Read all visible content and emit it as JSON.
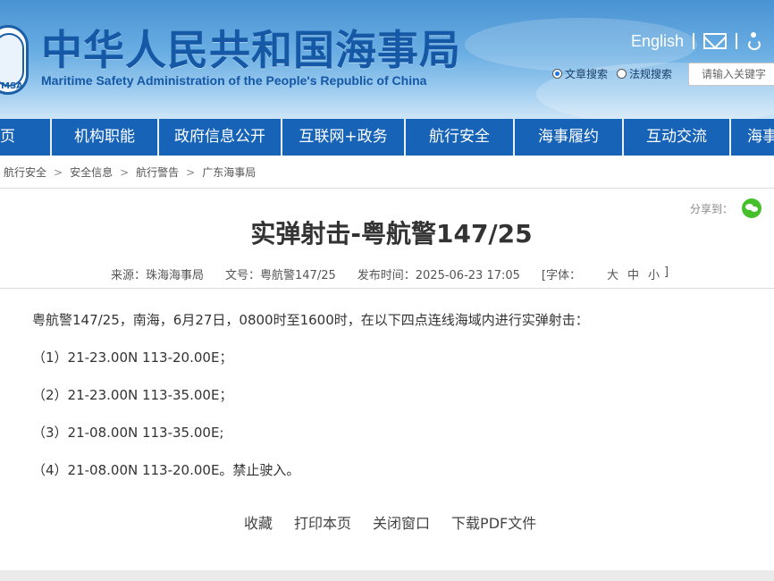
{
  "header": {
    "title_cn": "中华人民共和国海事局",
    "title_en": "Maritime Safety Administration of the People's Republic of China",
    "logo_text": "MSA",
    "english_link": "English",
    "search_options": [
      "文章搜索",
      "法规搜索"
    ],
    "search_placeholder": "请输入关键字"
  },
  "nav": {
    "items": [
      "首页",
      "机构职能",
      "政府信息公开",
      "互联网+政务",
      "航行安全",
      "海事履约",
      "互动交流",
      "海事服务"
    ]
  },
  "breadcrumb": [
    "航行安全",
    "安全信息",
    "航行警告",
    "广东海事局"
  ],
  "share_label": "分享到：",
  "article": {
    "title": "实弹射击-粤航警147/25",
    "source": "来源：珠海海事局",
    "doc_no": "文号：粤航警147/25",
    "publish_time": "发布时间：2025-06-23 17:05",
    "font_label": "[字体：",
    "font_sizes": [
      "大",
      "中",
      "小"
    ],
    "font_close": "]",
    "paragraphs": [
      "粤航警147/25，南海，6月27日，0800时至1600时，在以下四点连线海域内进行实弹射击：",
      "（1）21-23.00N 113-20.00E；",
      "（2）21-23.00N 113-35.00E；",
      "（3）21-08.00N 113-35.00E;",
      "（4）21-08.00N 113-20.00E。禁止驶入。"
    ]
  },
  "actions": [
    "收藏",
    "打印本页",
    "关闭窗口",
    "下载PDF文件"
  ],
  "colors": {
    "nav_bg": "#1763b7",
    "title_blue": "#1558a6",
    "wechat_green": "#46c02a"
  }
}
